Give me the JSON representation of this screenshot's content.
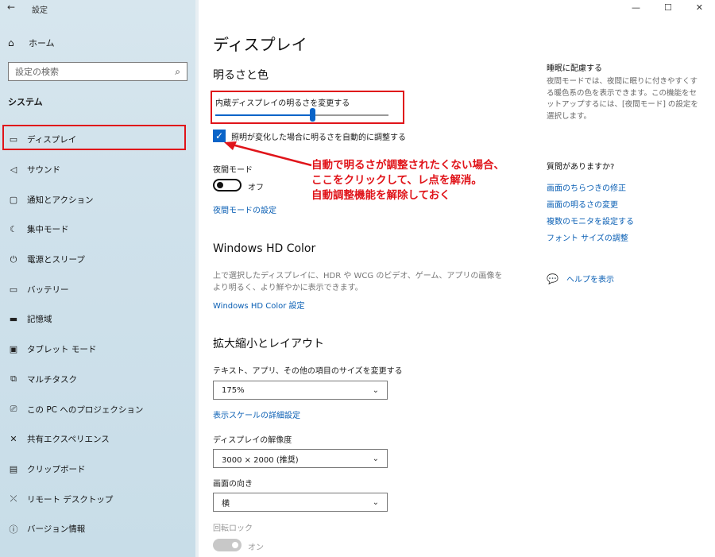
{
  "window": {
    "app_title": "設定",
    "back": "←",
    "controls": [
      "—",
      "☐",
      "✕"
    ]
  },
  "sidebar": {
    "home": "ホーム",
    "search_placeholder": "設定の検索",
    "section": "システム",
    "items": [
      {
        "label": "ディスプレイ",
        "icon": "monitor-icon"
      },
      {
        "label": "サウンド",
        "icon": "speaker-icon"
      },
      {
        "label": "通知とアクション",
        "icon": "notification-icon"
      },
      {
        "label": "集中モード",
        "icon": "moon-icon"
      },
      {
        "label": "電源とスリープ",
        "icon": "power-icon"
      },
      {
        "label": "バッテリー",
        "icon": "battery-icon"
      },
      {
        "label": "記憶域",
        "icon": "storage-icon"
      },
      {
        "label": "タブレット モード",
        "icon": "tablet-icon"
      },
      {
        "label": "マルチタスク",
        "icon": "multitask-icon"
      },
      {
        "label": "この PC へのプロジェクション",
        "icon": "projection-icon"
      },
      {
        "label": "共有エクスペリエンス",
        "icon": "share-icon"
      },
      {
        "label": "クリップボード",
        "icon": "clipboard-icon"
      },
      {
        "label": "リモート デスクトップ",
        "icon": "remote-icon"
      },
      {
        "label": "バージョン情報",
        "icon": "info-icon"
      }
    ]
  },
  "main": {
    "title": "ディスプレイ",
    "brightness_section": "明るさと色",
    "brightness_label": "内蔵ディスプレイの明るさを変更する",
    "brightness_value": 0.56,
    "auto_brightness_label": "照明が変化した場合に明るさを自動的に調整する",
    "auto_brightness_checked": true,
    "night_mode_label": "夜間モード",
    "night_mode_state": "オフ",
    "night_mode_link": "夜間モードの設定",
    "hdr_section": "Windows HD Color",
    "hdr_desc": "上で選択したディスプレイに、HDR や WCG のビデオ、ゲーム、アプリの画像をより明るく、より鮮やかに表示できます。",
    "hdr_link": "Windows HD Color 設定",
    "scale_section": "拡大縮小とレイアウト",
    "scale_label": "テキスト、アプリ、その他の項目のサイズを変更する",
    "scale_value": "175%",
    "scale_link": "表示スケールの詳細設定",
    "resolution_label": "ディスプレイの解像度",
    "resolution_value": "3000 × 2000 (推奨)",
    "orientation_label": "画面の向き",
    "orientation_value": "横",
    "rotation_lock_label": "回転ロック",
    "rotation_lock_state": "オン"
  },
  "annotation": {
    "lines": [
      "自動で明るさが調整されたくない場合、",
      "ここをクリックして、レ点を解消。",
      "自動調整機能を解除しておく"
    ],
    "color": "#e0141a"
  },
  "right": {
    "sleep_heading": "睡眠に配慮する",
    "sleep_desc": "夜間モードでは、夜間に眠りに付きやすくする暖色系の色を表示できます。この機能をセットアップするには、[夜間モード] の設定を選択します。",
    "questions_heading": "質問がありますか?",
    "links": [
      "画面のちらつきの修正",
      "画面の明るさの変更",
      "複数のモニタを設定する",
      "フォント サイズの調整"
    ],
    "help": "ヘルプを表示"
  },
  "colors": {
    "accent": "#0a64c8",
    "link": "#0a5fb4",
    "highlight": "#e0141a"
  }
}
